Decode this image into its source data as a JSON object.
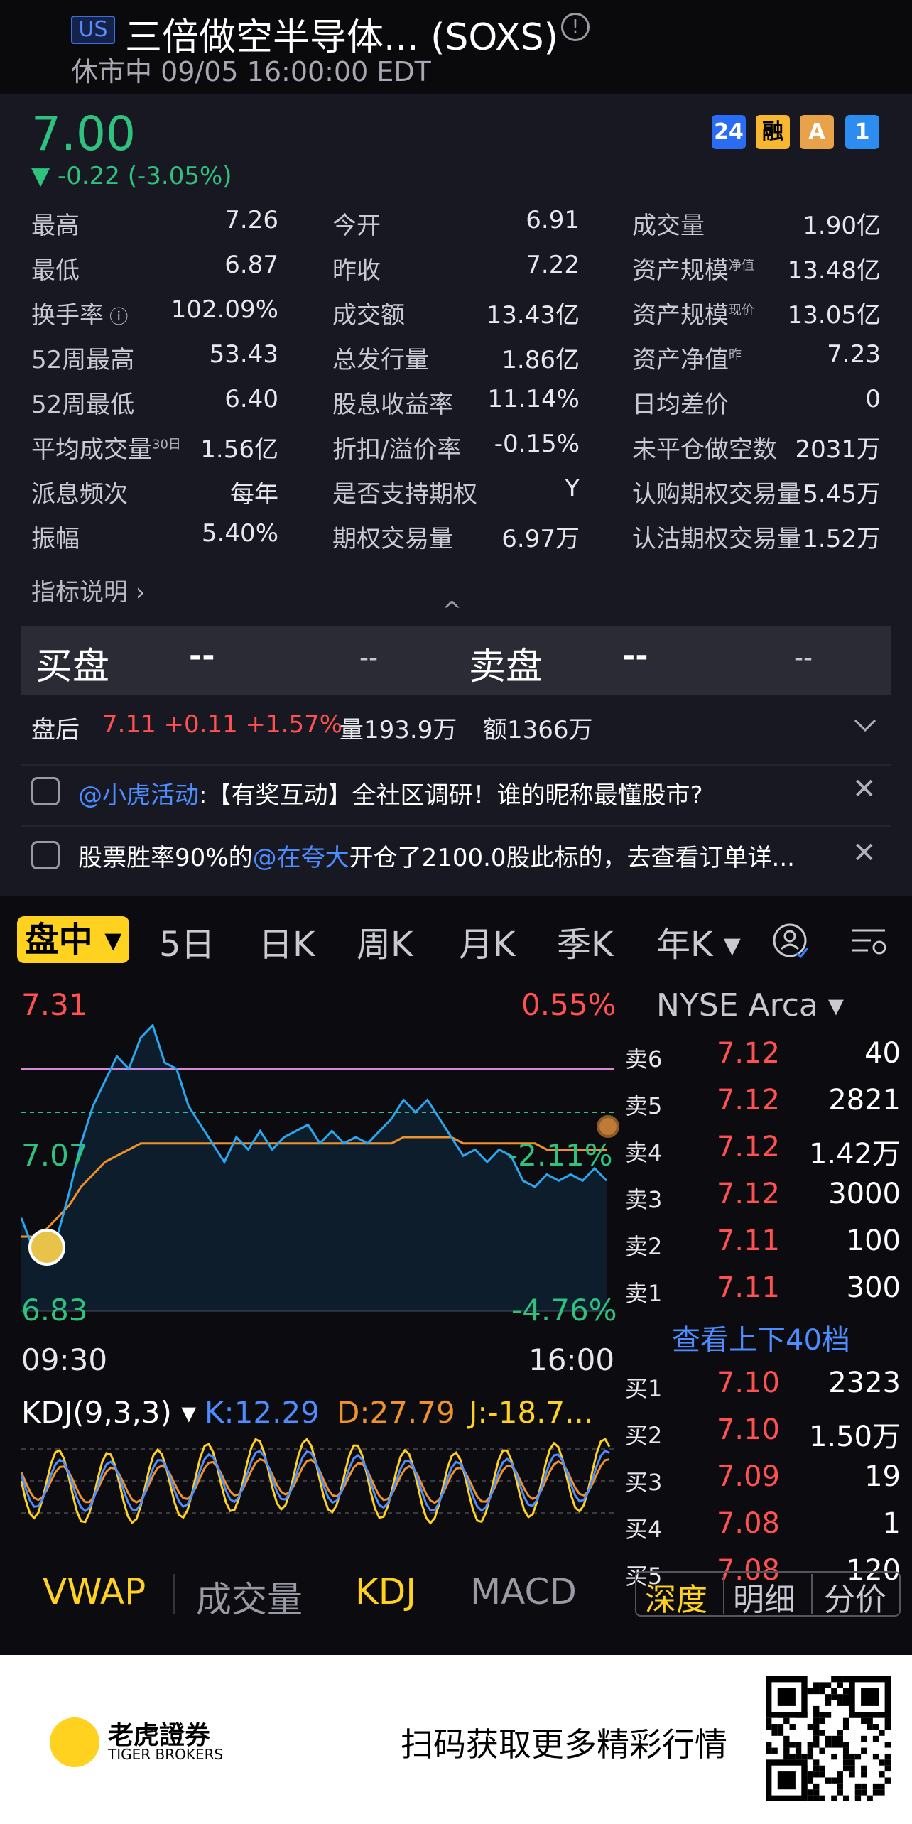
{
  "header": {
    "market_badge": "US",
    "title": "三倍做空半导体... (SOXS)",
    "status_line": "休市中 09/05 16:00:00 EDT"
  },
  "quote": {
    "price": "7.00",
    "change": "▼ -0.22 (-3.05%)",
    "badges": [
      "24",
      "融",
      "A",
      "1"
    ],
    "stats": [
      [
        {
          "label": "最高",
          "value": "7.26"
        },
        {
          "label": "今开",
          "value": "6.91"
        },
        {
          "label": "成交量",
          "value": "1.90亿"
        }
      ],
      [
        {
          "label": "最低",
          "value": "6.87"
        },
        {
          "label": "昨收",
          "value": "7.22"
        },
        {
          "label": "资产规模",
          "sup": "净值",
          "value": "13.48亿"
        }
      ],
      [
        {
          "label": "换手率",
          "value": "102.09%"
        },
        {
          "label": "成交额",
          "value": "13.43亿"
        },
        {
          "label": "资产规模",
          "sup": "现价",
          "value": "13.05亿"
        }
      ],
      [
        {
          "label": "52周最高",
          "value": "53.43"
        },
        {
          "label": "总发行量",
          "value": "1.86亿"
        },
        {
          "label": "资产净值",
          "sup": "昨",
          "value": "7.23"
        }
      ],
      [
        {
          "label": "52周最低",
          "value": "6.40"
        },
        {
          "label": "股息收益率",
          "value": "11.14%"
        },
        {
          "label": "日均差价",
          "value": "0"
        }
      ],
      [
        {
          "label": "平均成交量",
          "sup": "30日",
          "value": "1.56亿"
        },
        {
          "label": "折扣/溢价率",
          "value": "-0.15%"
        },
        {
          "label": "未平仓做空数",
          "value": "2031万"
        }
      ],
      [
        {
          "label": "派息频次",
          "value": "每年"
        },
        {
          "label": "是否支持期权",
          "value": "Y"
        },
        {
          "label": "认购期权交易量",
          "value": "5.45万"
        }
      ],
      [
        {
          "label": "振幅",
          "value": "5.40%"
        },
        {
          "label": "期权交易量",
          "value": "6.97万"
        },
        {
          "label": "认沽期权交易量",
          "value": "1.52万"
        }
      ]
    ],
    "indicator_link": "指标说明 ›",
    "collapse_icon": "^"
  },
  "order_summary": {
    "buy_label": "买盘",
    "buy_dash1": "--",
    "buy_dash2": "--",
    "sell_label": "卖盘",
    "sell_dash1": "--",
    "sell_dash2": "--"
  },
  "after_hours": {
    "label": "盘后",
    "price_change": "7.11 +0.11 +1.57%",
    "volume": "量193.9万",
    "amount": "额1366万",
    "expand_icon": "chevron-down"
  },
  "notices": [
    {
      "mention": "@小虎活动",
      "text": ":【有奖互动】全社区调研！谁的昵称最懂股市?"
    },
    {
      "prefix": "股票胜率90%的",
      "mention": "@在夸大",
      "text": "开仓了2100.0股此标的，去查看订单详..."
    }
  ],
  "chart_tabs": {
    "active": "盘中 ▾",
    "tabs": [
      "5日",
      "日K",
      "周K",
      "月K",
      "季K",
      "年K ▾"
    ]
  },
  "chart": {
    "y_high": "7.31",
    "y_mid": "7.07",
    "y_low": "6.83",
    "pct_high": "0.55%",
    "pct_mid": "-2.11%",
    "pct_low": "-4.76%",
    "time_start": "09:30",
    "time_end": "16:00",
    "exchange": "NYSE Arca ▾"
  },
  "chart_data": {
    "type": "line",
    "title": "",
    "x_range": [
      "09:30",
      "16:00"
    ],
    "ylim": [
      6.83,
      7.31
    ],
    "series": [
      {
        "name": "",
        "values": [
          6.98,
          6.93,
          6.91,
          6.95,
          7.02,
          7.1,
          7.16,
          7.2,
          7.24,
          7.22,
          7.27,
          7.29,
          7.23,
          7.22,
          7.16,
          7.13,
          7.1,
          7.07,
          7.11,
          7.09,
          7.12,
          7.09,
          7.11,
          7.12,
          7.13,
          7.1,
          7.12,
          7.1,
          7.11,
          7.1,
          7.12,
          7.14,
          7.17,
          7.15,
          7.17,
          7.14,
          7.11,
          7.08,
          7.09,
          7.07,
          7.09,
          7.08,
          7.04,
          7.03,
          7.05,
          7.04,
          7.05,
          7.04,
          7.06,
          7.04
        ]
      },
      {
        "name": "",
        "values": [
          6.95,
          6.95,
          6.96,
          6.98,
          7.0,
          7.03,
          7.05,
          7.07,
          7.08,
          7.09,
          7.1,
          7.1,
          7.1,
          7.1,
          7.1,
          7.1,
          7.1,
          7.1,
          7.1,
          7.1,
          7.1,
          7.1,
          7.1,
          7.1,
          7.1,
          7.1,
          7.1,
          7.1,
          7.1,
          7.1,
          7.1,
          7.1,
          7.11,
          7.11,
          7.11,
          7.11,
          7.11,
          7.1,
          7.1,
          7.1,
          7.1,
          7.1,
          7.1,
          7.1,
          7.09,
          7.09,
          7.09,
          7.09,
          7.09,
          7.09
        ]
      }
    ]
  },
  "order_book": {
    "asks": [
      {
        "side": "卖6",
        "price": "7.12",
        "vol": "40"
      },
      {
        "side": "卖5",
        "price": "7.12",
        "vol": "2821"
      },
      {
        "side": "卖4",
        "price": "7.12",
        "vol": "1.42万"
      },
      {
        "side": "卖3",
        "price": "7.12",
        "vol": "3000"
      },
      {
        "side": "卖2",
        "price": "7.11",
        "vol": "100"
      },
      {
        "side": "卖1",
        "price": "7.11",
        "vol": "300"
      }
    ],
    "view_more": "查看上下40档",
    "bids": [
      {
        "side": "买1",
        "price": "7.10",
        "vol": "2323"
      },
      {
        "side": "买2",
        "price": "7.10",
        "vol": "1.50万"
      },
      {
        "side": "买3",
        "price": "7.09",
        "vol": "19"
      },
      {
        "side": "买4",
        "price": "7.08",
        "vol": "1"
      },
      {
        "side": "买5",
        "price": "7.08",
        "vol": "120"
      }
    ]
  },
  "kdj": {
    "label": "KDJ(9,3,3) ▾",
    "k": "K:12.29",
    "d": "D:27.79",
    "j": "J:-18.7..."
  },
  "indicators": [
    "VWAP",
    "成交量",
    "KDJ",
    "MACD"
  ],
  "segments": [
    "深度",
    "明细",
    "分价"
  ],
  "footer": {
    "logo_cn": "老虎證券",
    "logo_en": "TIGER BROKERS",
    "scan_text": "扫码获取更多精彩行情"
  },
  "colors": {
    "up": "#ff5151",
    "down": "#2ec27e",
    "accent": "#ffd21f",
    "line": "#29a8f0",
    "avg": "#f0922b"
  }
}
